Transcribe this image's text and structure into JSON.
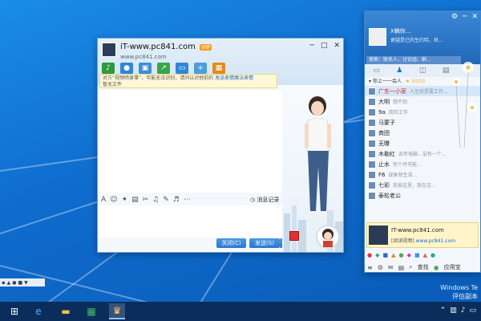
{
  "chat_window": {
    "title": "iT-www.pc841.com",
    "vip_badge": "VIP",
    "subtitle": "www.pc841.com",
    "window_controls": [
      "─",
      "□",
      "✕"
    ],
    "notice_text": "对方“视频喷泉事”，可能无法识别，请问以对他前的",
    "notice_link": "发送表情魔法表情",
    "notice_end": "暂无文件",
    "history_label": "消息记录",
    "close_button": "关闭(C)",
    "send_button": "发送(S)"
  },
  "qq_panel": {
    "nickname": "X稿你...",
    "signature": "更越是已的生约哈，机...",
    "search_placeholder": "搜索：联系人、讨论组、群...",
    "window_controls": [
      "⚙",
      "─",
      "✕"
    ],
    "group": {
      "name": "你上一一会人",
      "stars": "★ 10/15"
    },
    "contacts": [
      {
        "name": "广东一小家",
        "sig": "人生就是要工作...",
        "red": true
      },
      {
        "name": "大明",
        "sig": "想不到",
        "red": false
      },
      {
        "name": "9a",
        "sig": "我的工作",
        "red": false
      },
      {
        "name": "马蒙子",
        "sig": "",
        "red": false
      },
      {
        "name": "商团",
        "sig": "",
        "red": false
      },
      {
        "name": "无曝",
        "sig": "",
        "red": false
      },
      {
        "name": "木勒红",
        "sig": "去年电脑...没有一个...",
        "red": false
      },
      {
        "name": "止水",
        "sig": "你个丹可能...",
        "red": false
      },
      {
        "name": "F6",
        "sig": "现象就生活...",
        "red": false
      },
      {
        "name": "七彩",
        "sig": "我爱这里，我在这...",
        "red": false
      },
      {
        "name": "泰松老公",
        "sig": "",
        "red": false
      }
    ],
    "card": {
      "title": "IT-www.pc841.com",
      "status": "[阅读视频]",
      "link": "www.pc841.com"
    },
    "bottom_labels": {
      "search": "查找",
      "apps": "应用宝"
    }
  },
  "desktop": {
    "watermark_line1": "Windows Te",
    "watermark_line2": "评估副本"
  },
  "colors": {
    "desktop_blue": "#0f6ccd",
    "qq_header": "#2367b8",
    "send_button": "#2a78cd",
    "taskbar": "#0b2d5c"
  }
}
